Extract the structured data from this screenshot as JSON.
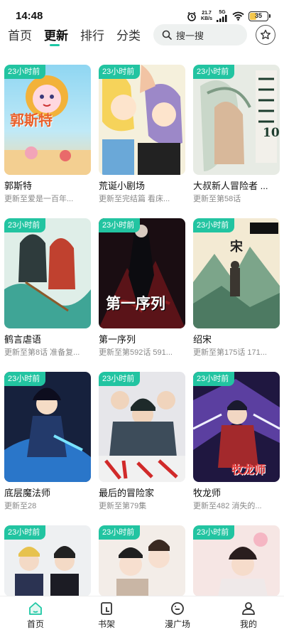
{
  "status_bar": {
    "time": "14:48",
    "net_speed_value": "21.7",
    "net_speed_unit": "KB/s",
    "signal_label": "5G",
    "battery": "35",
    "battery_level": 0.35
  },
  "header": {
    "tabs": [
      {
        "label": "首页",
        "active": false
      },
      {
        "label": "更新",
        "active": true
      },
      {
        "label": "排行",
        "active": false
      },
      {
        "label": "分类",
        "active": false
      }
    ],
    "search_placeholder": "搜一搜"
  },
  "comics": [
    {
      "badge": "23小时前",
      "title": "郭斯特",
      "subtitle": "更新至爱是一百年...",
      "cover_text": "郭斯特"
    },
    {
      "badge": "23小时前",
      "title": "荒诞小剧场",
      "subtitle": "更新至完结篇 看床...",
      "cover_text": ""
    },
    {
      "badge": "23小时前",
      "title": "大叔新人冒险者 ...",
      "subtitle": "更新至第58话",
      "cover_text": "10"
    },
    {
      "badge": "23小时前",
      "title": "鹤言虐语",
      "subtitle": "更新至第8话 准备复...",
      "cover_text": ""
    },
    {
      "badge": "23小时前",
      "title": "第一序列",
      "subtitle": "更新至第592话 591...",
      "cover_text": "第一序列"
    },
    {
      "badge": "23小时前",
      "title": "绍宋",
      "subtitle": "更新至第175话 171...",
      "cover_text": "宋"
    },
    {
      "badge": "23小时前",
      "title": "底层魔法师",
      "subtitle": "更新至28",
      "cover_text": ""
    },
    {
      "badge": "23小时前",
      "title": "最后的冒险家",
      "subtitle": "更新至第79集",
      "cover_text": ""
    },
    {
      "badge": "23小时前",
      "title": "牧龙师",
      "subtitle": "更新至482 消失的...",
      "cover_text": "牧龙师"
    },
    {
      "badge": "23小时前",
      "title": "",
      "subtitle": "",
      "cover_text": ""
    },
    {
      "badge": "23小时前",
      "title": "",
      "subtitle": "",
      "cover_text": ""
    },
    {
      "badge": "23小时前",
      "title": "",
      "subtitle": "",
      "cover_text": ""
    }
  ],
  "bottom_nav": {
    "items": [
      {
        "label": "首页",
        "icon": "home-icon"
      },
      {
        "label": "书架",
        "icon": "bookshelf-icon"
      },
      {
        "label": "漫广场",
        "icon": "square-icon"
      },
      {
        "label": "我的",
        "icon": "profile-icon"
      }
    ]
  },
  "colors": {
    "accent": "#22c4a1",
    "badge_bg": "#22c4a1",
    "search_bg": "#eef1f0"
  }
}
